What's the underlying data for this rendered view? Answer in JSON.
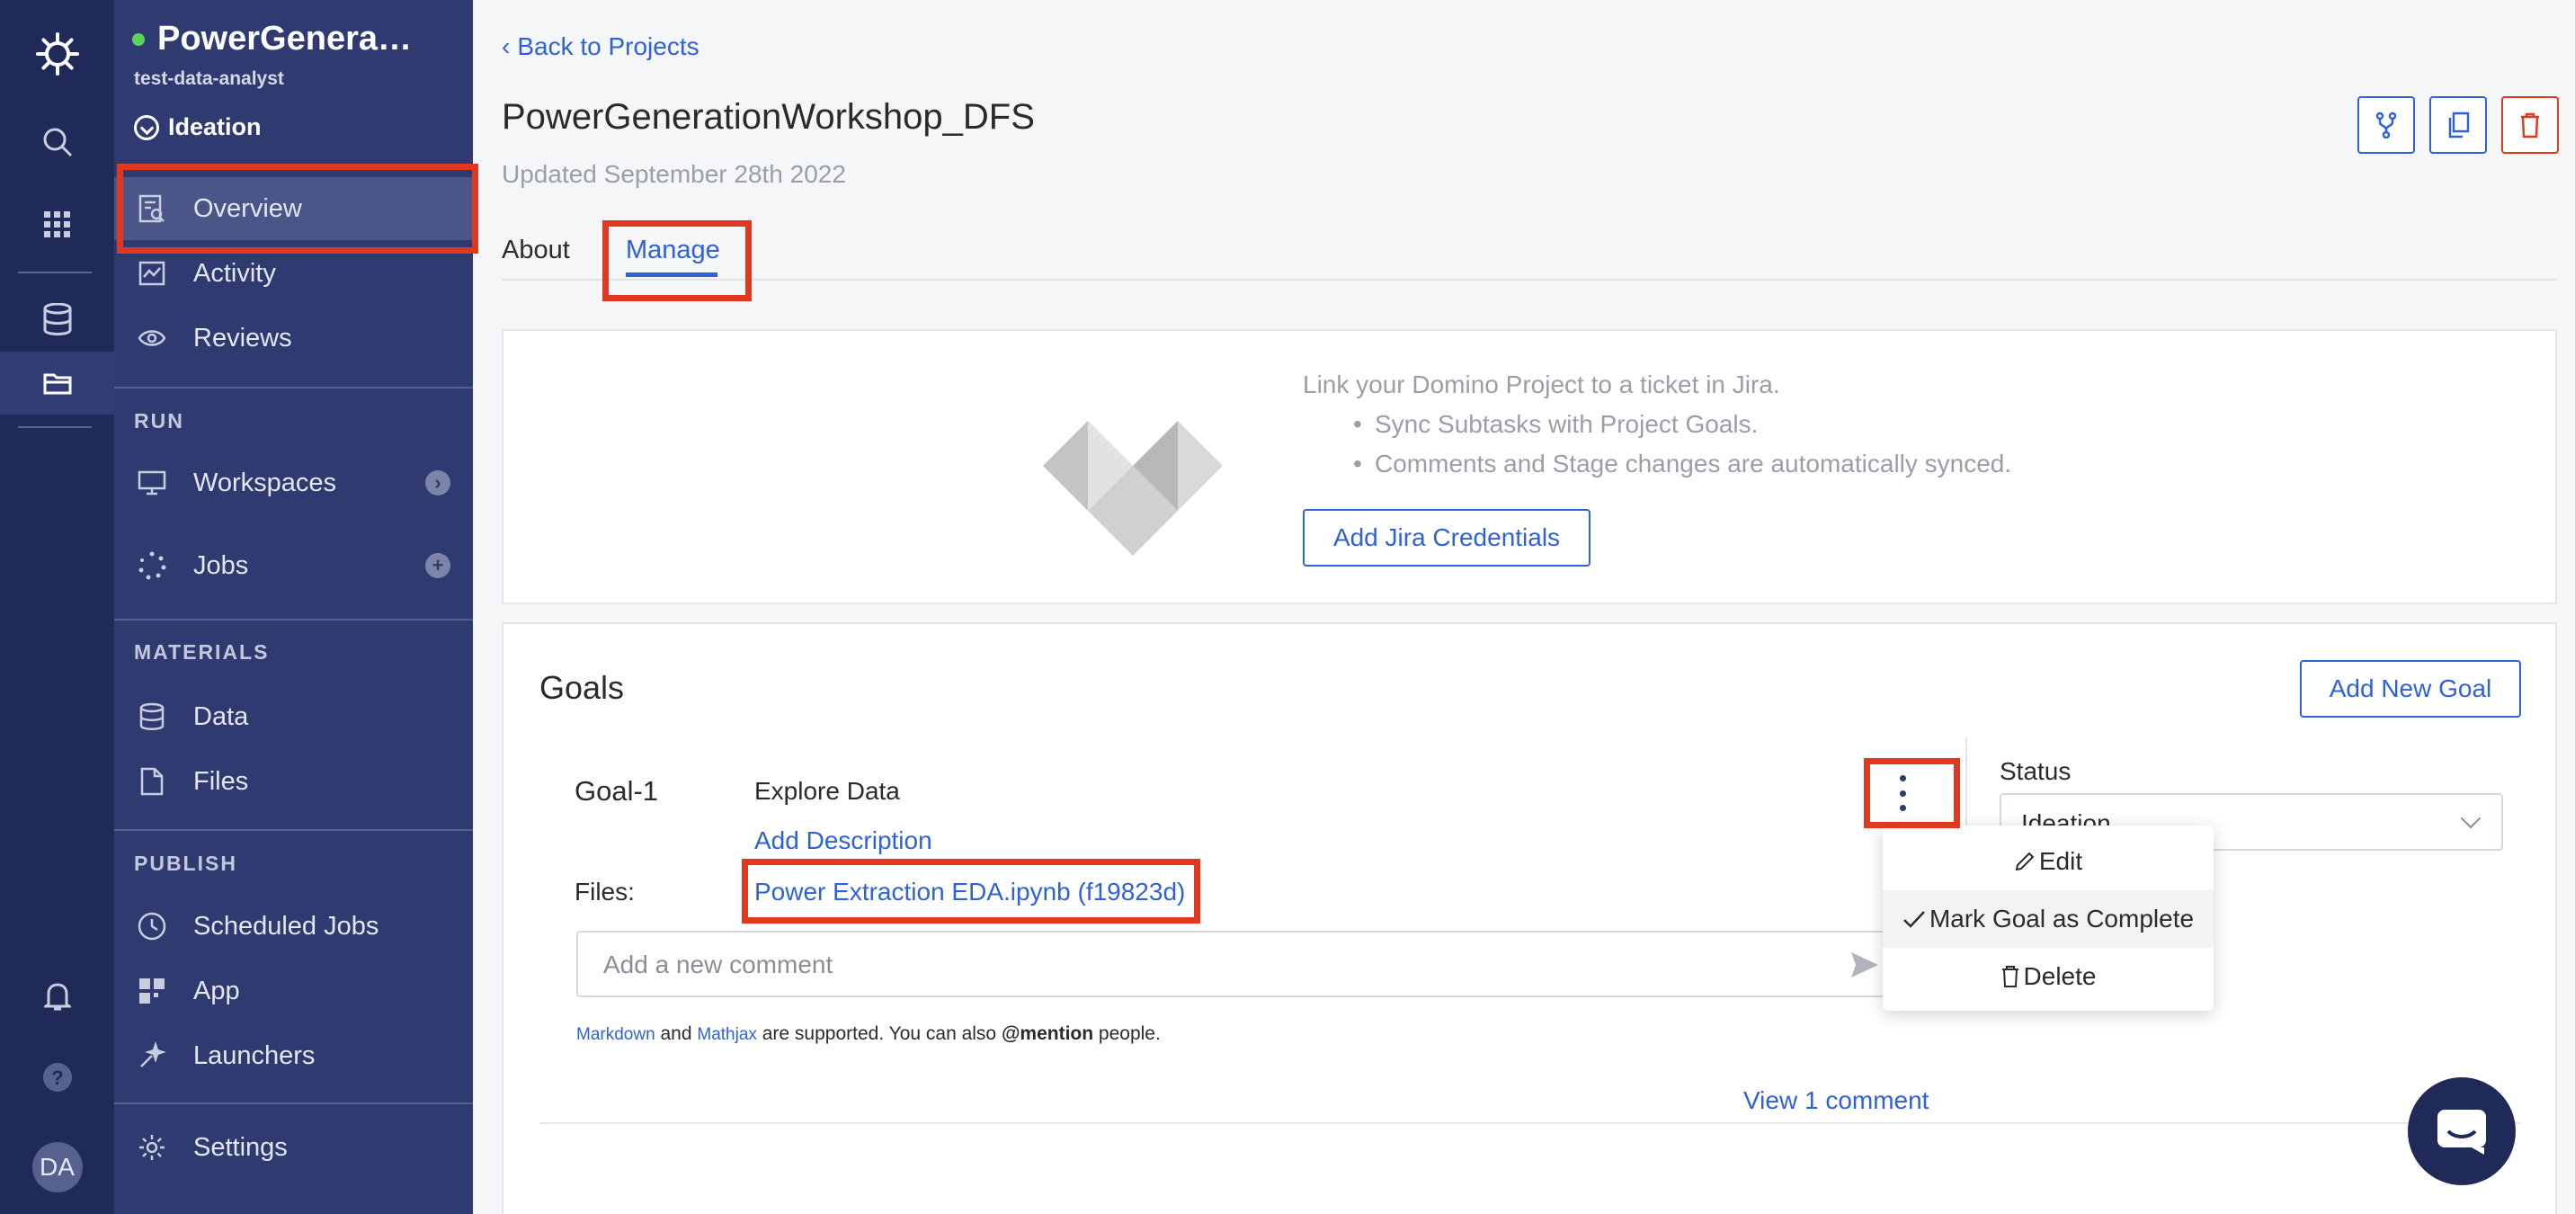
{
  "rail": {
    "icons": [
      "domino-logo-icon",
      "search-icon",
      "apps-grid-icon",
      "database-icon",
      "folder-icon",
      "bell-icon",
      "help-icon"
    ],
    "avatar_initials": "DA"
  },
  "sidebar": {
    "project_name": "PowerGenera…",
    "owner": "test-data-analyst",
    "stage": "Ideation",
    "items": [
      {
        "label": "Overview"
      },
      {
        "label": "Activity"
      },
      {
        "label": "Reviews"
      }
    ],
    "run_label": "RUN",
    "run_items": [
      {
        "label": "Workspaces"
      },
      {
        "label": "Jobs"
      }
    ],
    "materials_label": "MATERIALS",
    "materials_items": [
      {
        "label": "Data"
      },
      {
        "label": "Files"
      }
    ],
    "publish_label": "PUBLISH",
    "publish_items": [
      {
        "label": "Scheduled Jobs"
      },
      {
        "label": "App"
      },
      {
        "label": "Launchers"
      }
    ],
    "settings_label": "Settings"
  },
  "header": {
    "back_link": "Back to Projects",
    "title": "PowerGenerationWorkshop_DFS",
    "updated": "Updated September 28th 2022"
  },
  "tabs": [
    {
      "label": "About"
    },
    {
      "label": "Manage"
    }
  ],
  "jira": {
    "heading": "Link your Domino Project to a ticket in Jira.",
    "bullets": [
      "Sync Subtasks with Project Goals.",
      "Comments and Stage changes are automatically synced."
    ],
    "button": "Add Jira Credentials"
  },
  "goals": {
    "title": "Goals",
    "add_button": "Add New Goal",
    "goal": {
      "id": "Goal-1",
      "name": "Explore Data",
      "add_description": "Add Description",
      "files_label": "Files:",
      "file_link": "Power Extraction EDA.ipynb (f19823d)",
      "comment_placeholder": "Add a new comment",
      "note_markdown": "Markdown",
      "note_and": " and ",
      "note_mathjax": "Mathjax",
      "note_rest": " are supported. You can also ",
      "note_mention": "@mention",
      "note_end": " people.",
      "view_comments": "View 1 comment",
      "status_label": "Status",
      "status_value": "Ideation"
    },
    "menu": [
      {
        "label": "Edit",
        "icon": "pencil-icon"
      },
      {
        "label": "Mark Goal as Complete",
        "icon": "check-icon"
      },
      {
        "label": "Delete",
        "icon": "trash-icon"
      }
    ]
  },
  "colors": {
    "rail": "#1f2a58",
    "sidebar": "#2e3a70",
    "accent": "#2f62d6",
    "highlight_box": "#e0391f",
    "status_dot": "#5bd35b"
  }
}
